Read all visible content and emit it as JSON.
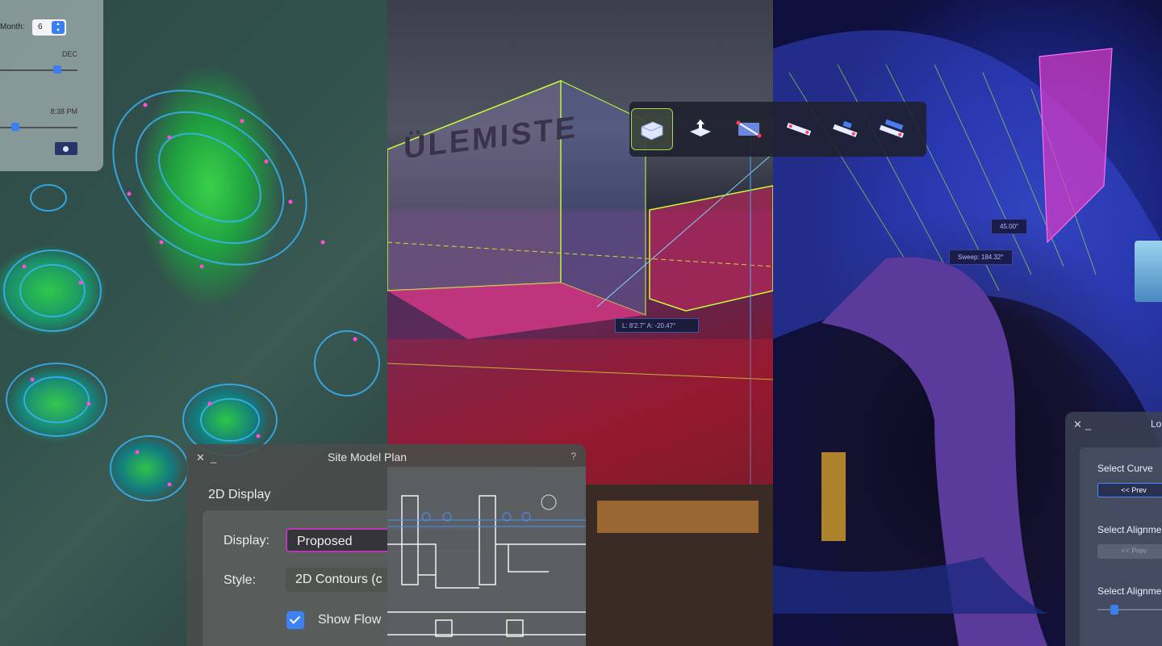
{
  "sun_widget": {
    "month_label": "Month:",
    "month_value": "6",
    "month_end_label": "DEC",
    "time_label": "8:38 PM",
    "night_icon": "moon-icon"
  },
  "building": {
    "sign_text": "ÜLEMISTE",
    "dimension_readout": "L: 8'2.7\"   A: -20.47°"
  },
  "toolbar": {
    "tools": [
      {
        "icon": "solid-block-icon",
        "selected": true
      },
      {
        "icon": "push-pull-icon",
        "selected": false
      },
      {
        "icon": "section-plane-icon",
        "selected": false
      },
      {
        "icon": "dimension-chain-icon",
        "selected": false
      },
      {
        "icon": "stepped-dimension-icon",
        "selected": false
      },
      {
        "icon": "hierarchy-dimension-icon",
        "selected": false
      }
    ]
  },
  "stage": {
    "angle_tag": "45.00°",
    "sweep_tag": "Sweep: 184.32°"
  },
  "site_dialog": {
    "close_glyph": "✕",
    "minimize_glyph": "_",
    "title": "Site Model Plan",
    "help_glyph": "?",
    "section_heading": "2D Display",
    "display_label": "Display:",
    "display_value": "Proposed",
    "style_label": "Style:",
    "style_value": "2D Contours (c",
    "show_flow_label": "Show Flow",
    "show_flow_checked": true
  },
  "curve_dialog": {
    "close_glyph": "✕",
    "minimize_glyph": "_",
    "title": "Lo",
    "select_curve_label": "Select Curve",
    "prev_button_label": "<< Prev",
    "select_alignment_label_1": "Select Alignmer",
    "prev_button_disabled_label": "<< Prev",
    "select_alignment_label_2": "Select Alignmer"
  },
  "colors": {
    "accent_blue": "#3a7ef0",
    "focus_magenta": "#b43ab8",
    "tool_selected": "#a7d35a"
  }
}
